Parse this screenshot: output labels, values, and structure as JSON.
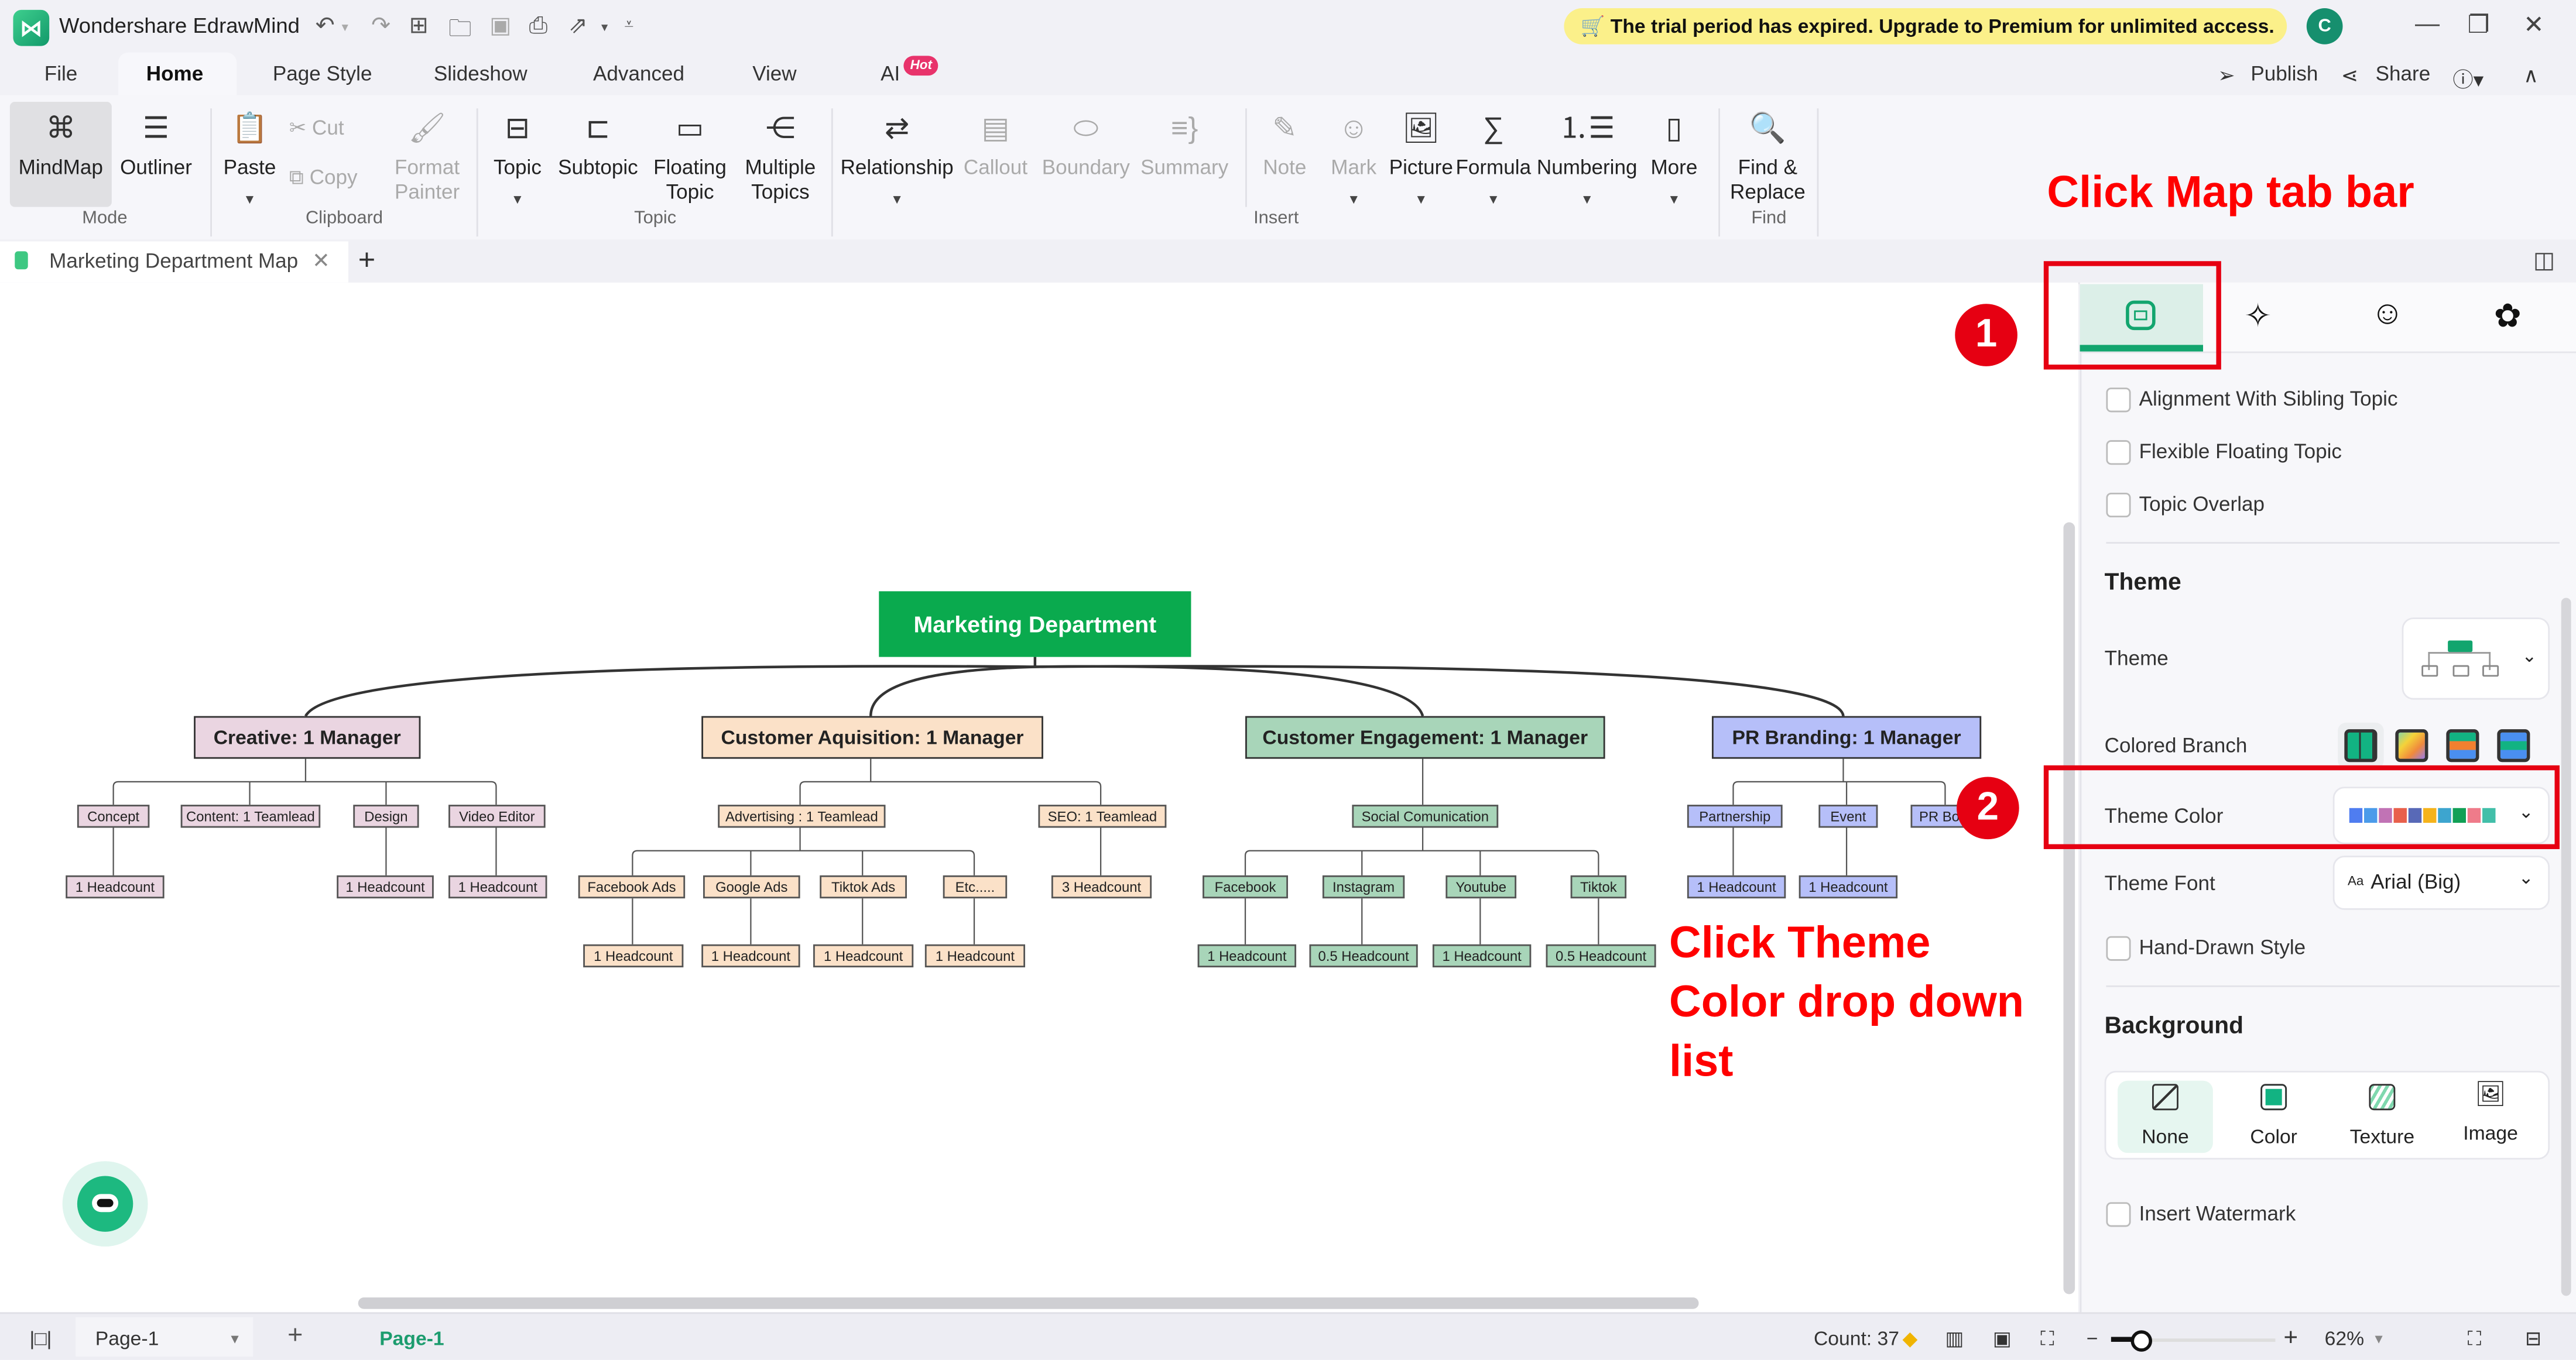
{
  "app": {
    "name": "Wondershare EdrawMind",
    "trial_banner": "The trial period has expired. Upgrade to Premium for unlimited access.",
    "avatar_initial": "C"
  },
  "menu_tabs": [
    {
      "label": "File"
    },
    {
      "label": "Home",
      "active": true
    },
    {
      "label": "Page Style"
    },
    {
      "label": "Slideshow"
    },
    {
      "label": "Advanced"
    },
    {
      "label": "View"
    },
    {
      "label": "AI",
      "badge": "Hot"
    }
  ],
  "right_actions": {
    "publish": "Publish",
    "share": "Share"
  },
  "ribbon": {
    "mode": {
      "group": "Mode",
      "mindmap": "MindMap",
      "outliner": "Outliner"
    },
    "clipboard": {
      "group": "Clipboard",
      "paste": "Paste",
      "cut": "Cut",
      "copy": "Copy",
      "format_painter_1": "Format",
      "format_painter_2": "Painter"
    },
    "topic": {
      "group": "Topic",
      "topic": "Topic",
      "subtopic": "Subtopic",
      "floating_1": "Floating",
      "floating_2": "Topic",
      "multiple_1": "Multiple",
      "multiple_2": "Topics"
    },
    "insert": {
      "group": "Insert",
      "relationship": "Relationship",
      "callout": "Callout",
      "boundary": "Boundary",
      "summary": "Summary",
      "note": "Note",
      "mark": "Mark",
      "picture": "Picture",
      "formula": "Formula",
      "numbering": "Numbering",
      "more": "More"
    },
    "find": {
      "group": "Find",
      "find_1": "Find &",
      "find_2": "Replace"
    }
  },
  "document_tab": {
    "title": "Marketing Department Map"
  },
  "mindmap": {
    "root": "Marketing Department",
    "branches": {
      "creative": "Creative: 1 Manager",
      "acquisition": "Customer Aquisition: 1 Manager",
      "engagement": "Customer Engagement: 1 Manager",
      "pr": "PR Branding: 1 Manager"
    },
    "creative": {
      "concept": "Concept",
      "content": "Content: 1 Teamlead",
      "design": "Design",
      "video": "Video Editor",
      "concept_hc": "1 Headcount",
      "design_hc": "1 Headcount",
      "video_hc": "1 Headcount"
    },
    "acquisition": {
      "advertising": "Advertising : 1 Teamlead",
      "seo": "SEO: 1 Teamlead",
      "facebook_ads": "Facebook Ads",
      "google_ads": "Google Ads",
      "tiktok_ads": "Tiktok Ads",
      "etc": "Etc.....",
      "seo_hc": "3 Headcount",
      "fb_hc": "1 Headcount",
      "google_hc": "1 Headcount",
      "tiktok_hc": "1 Headcount",
      "etc_hc": "1 Headcount"
    },
    "engagement": {
      "social": "Social Comunication",
      "facebook": "Facebook",
      "instagram": "Instagram",
      "youtube": "Youtube",
      "tiktok": "Tiktok",
      "facebook_hc": "1 Headcount",
      "instagram_hc": "0.5 Headcount",
      "youtube_hc": "1 Headcount",
      "tiktok_hc": "0.5 Headcount"
    },
    "pr": {
      "partnership": "Partnership",
      "event": "Event",
      "pr_bo": "PR Bo...",
      "partnership_hc": "1 Headcount",
      "event_hc": "1 Headcount"
    }
  },
  "annotations": {
    "step1_label": "Click Map tab bar",
    "step1_number": "1",
    "step2_label_line1": "Click Theme",
    "step2_label_line2": "Color drop down",
    "step2_label_line3": "list",
    "step2_number": "2"
  },
  "panel": {
    "checkboxes": [
      {
        "label": "Alignment With Sibling Topic",
        "checked": false
      },
      {
        "label": "Flexible Floating Topic",
        "checked": false
      },
      {
        "label": "Topic Overlap",
        "checked": false
      }
    ],
    "theme_section": "Theme",
    "theme_label": "Theme",
    "colored_branch_label": "Colored Branch",
    "theme_color_label": "Theme Color",
    "theme_colors": [
      "#4f7df0",
      "#4b9bea",
      "#c173b5",
      "#e8604c",
      "#5869b7",
      "#f5b31c",
      "#3da5cf",
      "#12a056",
      "#ef7b8a",
      "#42bfa9"
    ],
    "theme_font_label": "Theme Font",
    "theme_font_value": "Arial (Big)",
    "hand_drawn_label": "Hand-Drawn Style",
    "background_section": "Background",
    "background_options": [
      {
        "label": "None",
        "selected": true
      },
      {
        "label": "Color"
      },
      {
        "label": "Texture"
      },
      {
        "label": "Image"
      }
    ],
    "watermark_label": "Insert Watermark"
  },
  "status": {
    "page_selector": "Page-1",
    "active_page": "Page-1",
    "count": "Count: 37",
    "zoom": "62%"
  },
  "colors": {
    "accent": "#12a56e",
    "root_node": "#0aaa4e",
    "annotation_red": "#e60012"
  }
}
